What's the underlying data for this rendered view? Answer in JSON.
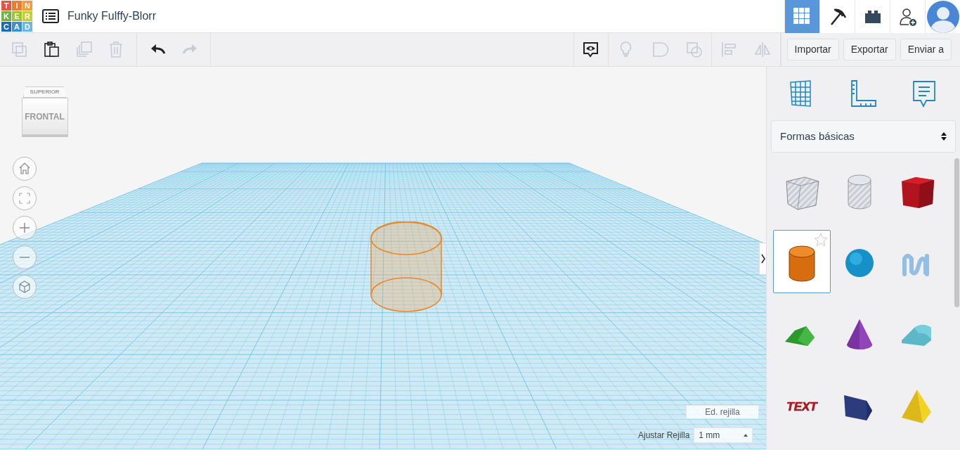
{
  "logo": {
    "letters": [
      {
        "text": "T",
        "color": "#e8553d"
      },
      {
        "text": "I",
        "color": "#f07b2e"
      },
      {
        "text": "N",
        "color": "#f59a3a"
      },
      {
        "text": "K",
        "color": "#6cb543"
      },
      {
        "text": "E",
        "color": "#9cc33a"
      },
      {
        "text": "R",
        "color": "#c3cf32"
      },
      {
        "text": "C",
        "color": "#1c6bb3"
      },
      {
        "text": "A",
        "color": "#3a8fd0"
      },
      {
        "text": "D",
        "color": "#6eb6e2"
      }
    ]
  },
  "title": "Funky Fulffy-Blorr",
  "nav_buttons": [
    {
      "kind": "grid",
      "selected": true
    },
    {
      "kind": "pickaxe",
      "selected": false
    },
    {
      "kind": "brick",
      "selected": false
    },
    {
      "kind": "add-user",
      "selected": false
    },
    {
      "kind": "avatar",
      "selected": false
    }
  ],
  "edit_tools": [
    {
      "kind": "copy",
      "disabled": true
    },
    {
      "kind": "paste",
      "disabled": false
    },
    {
      "kind": "duplicate",
      "disabled": true
    },
    {
      "kind": "delete",
      "disabled": true
    }
  ],
  "history_tools": [
    {
      "kind": "undo",
      "disabled": false
    },
    {
      "kind": "redo",
      "disabled": true
    }
  ],
  "shape_tools": [
    {
      "kind": "notes",
      "disabled": false
    },
    {
      "kind": "light",
      "disabled": true
    },
    {
      "kind": "group",
      "disabled": true
    },
    {
      "kind": "ungroup",
      "disabled": true
    },
    {
      "kind": "align",
      "disabled": true
    },
    {
      "kind": "mirror",
      "disabled": true
    }
  ],
  "actions": [
    "Importar",
    "Exportar",
    "Enviar a"
  ],
  "view_cube": {
    "top": "SUPERIOR",
    "front": "FRONTAL"
  },
  "view_controls": [
    {
      "kind": "home"
    },
    {
      "kind": "fit"
    },
    {
      "kind": "zoom-in"
    },
    {
      "kind": "zoom-out"
    },
    {
      "kind": "perspective"
    }
  ],
  "panel_tools": [
    {
      "kind": "workplane"
    },
    {
      "kind": "ruler"
    },
    {
      "kind": "notes"
    }
  ],
  "library": {
    "value": "Formas básicas"
  },
  "shapes": [
    {
      "kind": "box-hole",
      "selected": false
    },
    {
      "kind": "cylinder-hole",
      "selected": false
    },
    {
      "kind": "box",
      "selected": false
    },
    {
      "kind": "cylinder",
      "selected": true
    },
    {
      "kind": "sphere",
      "selected": false
    },
    {
      "kind": "scribble",
      "selected": false
    },
    {
      "kind": "roof",
      "selected": false
    },
    {
      "kind": "cone",
      "selected": false
    },
    {
      "kind": "round-roof",
      "selected": false
    },
    {
      "kind": "text",
      "label": "TEXT",
      "selected": false
    },
    {
      "kind": "polygon",
      "selected": false
    },
    {
      "kind": "pyramid",
      "selected": false
    }
  ],
  "grid_edit": "Ed. rejilla",
  "snap": {
    "label": "Ajustar Rejilla",
    "value": "1 mm"
  }
}
